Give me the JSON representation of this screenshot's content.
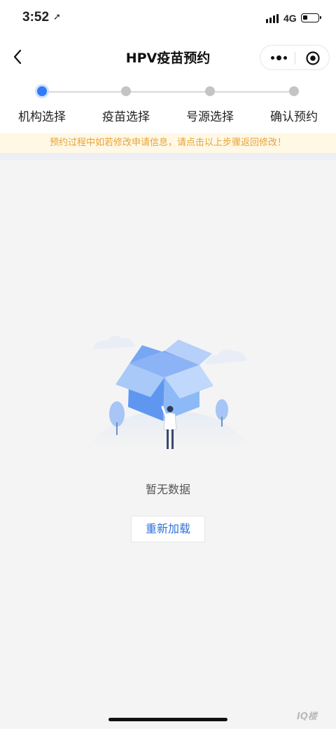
{
  "status_bar": {
    "time": "3:52",
    "network": "4G"
  },
  "navbar": {
    "title": "HPV疫苗预约"
  },
  "steps": [
    {
      "label": "机构选择",
      "active": true
    },
    {
      "label": "疫苗选择",
      "active": false
    },
    {
      "label": "号源选择",
      "active": false
    },
    {
      "label": "确认预约",
      "active": false
    }
  ],
  "notice": "预约过程中如若修改申请信息，请点击以上步骤返回修改！",
  "empty": {
    "message": "暂无数据",
    "reload_label": "重新加载"
  },
  "watermark": "IQ楼",
  "colors": {
    "accent": "#2f7cf6",
    "notice_text": "#e8a23a",
    "notice_bg": "#fef8e4"
  }
}
